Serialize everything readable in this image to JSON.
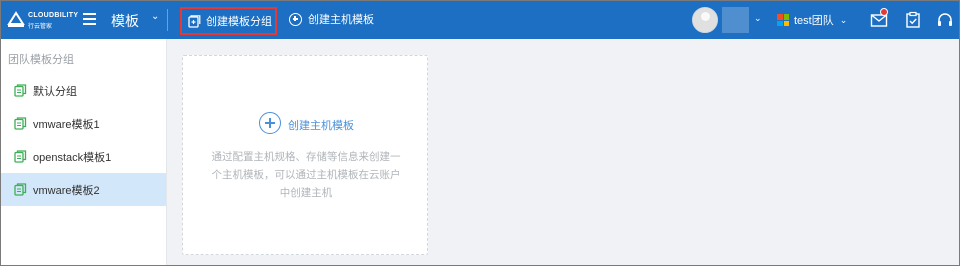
{
  "header": {
    "brand_name": "CLOUDBILITY",
    "brand_sub": "行云管家",
    "app_title": "模板",
    "create_group_label": "创建模板分组",
    "create_template_label": "创建主机模板",
    "team_label": "test团队",
    "accent_color": "#1c6fc2",
    "highlight_color": "#e53935"
  },
  "sidebar": {
    "title": "团队模板分组",
    "items": [
      {
        "label": "默认分组",
        "icon": "template-icon",
        "active": false
      },
      {
        "label": "vmware模板1",
        "icon": "template-icon",
        "active": false
      },
      {
        "label": "openstack模板1",
        "icon": "template-icon",
        "active": false
      },
      {
        "label": "vmware模板2",
        "icon": "template-icon",
        "active": true
      }
    ],
    "active_color": "#d3e7fa",
    "icon_color": "#3cb054"
  },
  "main": {
    "card": {
      "action_label": "创建主机模板",
      "description": "通过配置主机规格、存储等信息来创建一个主机模板，可以通过主机模板在云账户中创建主机"
    }
  }
}
